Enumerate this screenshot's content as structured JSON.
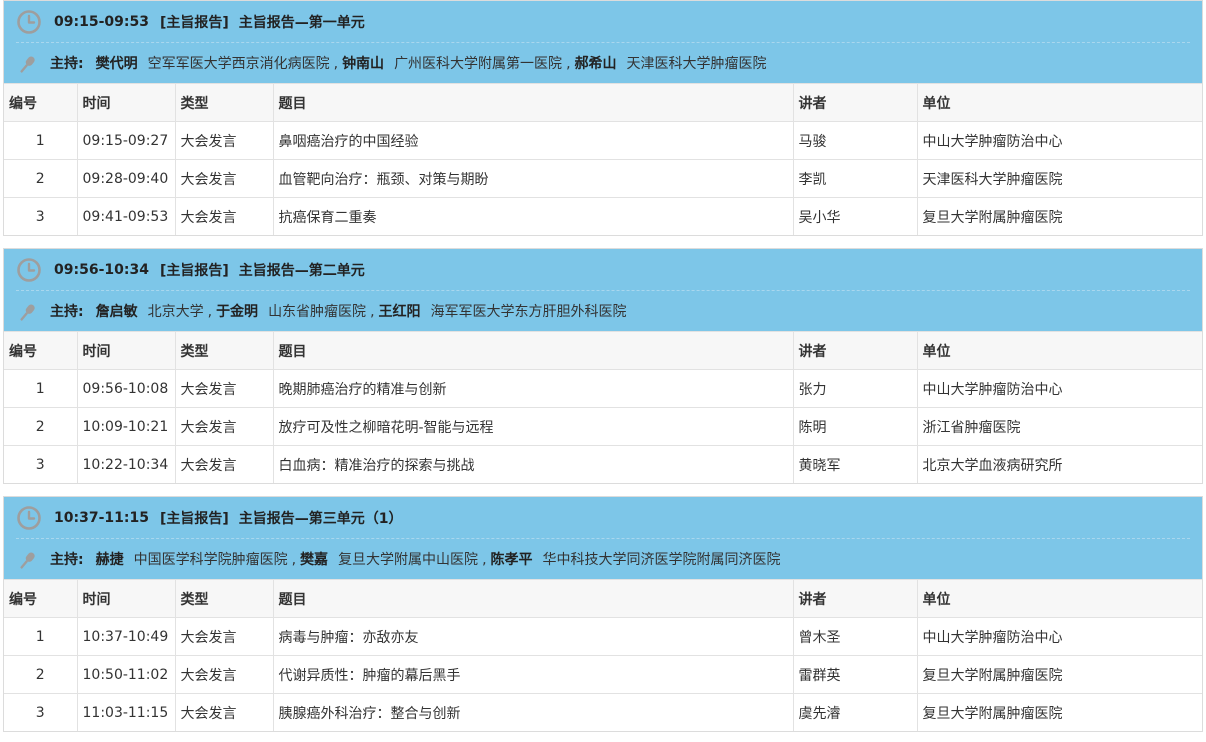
{
  "columns": [
    "编号",
    "时间",
    "类型",
    "题目",
    "讲者",
    "单位"
  ],
  "chair_label": "主持:",
  "colors": {
    "header_bg": "#7dc6e8",
    "icon": "#9e9e9e"
  },
  "sessions": [
    {
      "time": "09:15-09:53",
      "tag": "[主旨报告]",
      "title": "主旨报告—第一单元",
      "chairs": [
        {
          "name": "樊代明",
          "org": "空军军医大学西京消化病医院"
        },
        {
          "name": "钟南山",
          "org": "广州医科大学附属第一医院"
        },
        {
          "name": "郝希山",
          "org": "天津医科大学肿瘤医院"
        }
      ],
      "rows": [
        {
          "no": "1",
          "time": "09:15-09:27",
          "type": "大会发言",
          "topic": "鼻咽癌治疗的中国经验",
          "speaker": "马骏",
          "unit": "中山大学肿瘤防治中心"
        },
        {
          "no": "2",
          "time": "09:28-09:40",
          "type": "大会发言",
          "topic": "血管靶向治疗：瓶颈、对策与期盼",
          "speaker": "李凯",
          "unit": "天津医科大学肿瘤医院"
        },
        {
          "no": "3",
          "time": "09:41-09:53",
          "type": "大会发言",
          "topic": "抗癌保育二重奏",
          "speaker": "吴小华",
          "unit": "复旦大学附属肿瘤医院"
        }
      ]
    },
    {
      "time": "09:56-10:34",
      "tag": "[主旨报告]",
      "title": "主旨报告—第二单元",
      "chairs": [
        {
          "name": "詹启敏",
          "org": "北京大学"
        },
        {
          "name": "于金明",
          "org": "山东省肿瘤医院"
        },
        {
          "name": "王红阳",
          "org": "海军军医大学东方肝胆外科医院"
        }
      ],
      "rows": [
        {
          "no": "1",
          "time": "09:56-10:08",
          "type": "大会发言",
          "topic": "晚期肺癌治疗的精准与创新",
          "speaker": "张力",
          "unit": "中山大学肿瘤防治中心"
        },
        {
          "no": "2",
          "time": "10:09-10:21",
          "type": "大会发言",
          "topic": "放疗可及性之柳暗花明-智能与远程",
          "speaker": "陈明",
          "unit": "浙江省肿瘤医院"
        },
        {
          "no": "3",
          "time": "10:22-10:34",
          "type": "大会发言",
          "topic": "白血病：精准治疗的探索与挑战",
          "speaker": "黄晓军",
          "unit": "北京大学血液病研究所"
        }
      ]
    },
    {
      "time": "10:37-11:15",
      "tag": "[主旨报告]",
      "title": "主旨报告—第三单元（1）",
      "chairs": [
        {
          "name": "赫捷",
          "org": "中国医学科学院肿瘤医院"
        },
        {
          "name": "樊嘉",
          "org": "复旦大学附属中山医院"
        },
        {
          "name": "陈孝平",
          "org": "华中科技大学同济医学院附属同济医院"
        }
      ],
      "rows": [
        {
          "no": "1",
          "time": "10:37-10:49",
          "type": "大会发言",
          "topic": "病毒与肿瘤：亦敌亦友",
          "speaker": "曾木圣",
          "unit": "中山大学肿瘤防治中心"
        },
        {
          "no": "2",
          "time": "10:50-11:02",
          "type": "大会发言",
          "topic": "代谢异质性：肿瘤的幕后黑手",
          "speaker": "雷群英",
          "unit": "复旦大学附属肿瘤医院"
        },
        {
          "no": "3",
          "time": "11:03-11:15",
          "type": "大会发言",
          "topic": "胰腺癌外科治疗：整合与创新",
          "speaker": "虞先濬",
          "unit": "复旦大学附属肿瘤医院"
        }
      ]
    }
  ]
}
